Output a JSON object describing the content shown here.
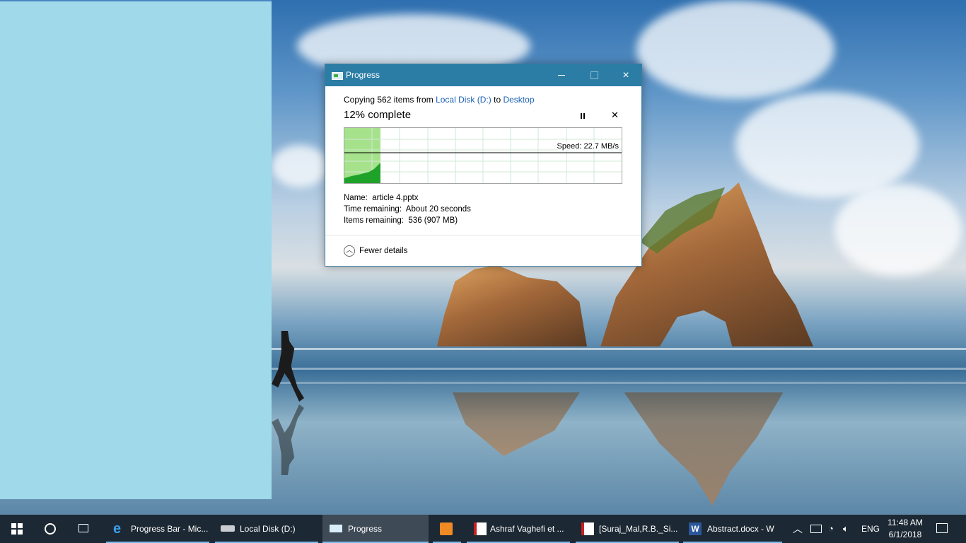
{
  "dialog": {
    "title": "Progress",
    "copy_prefix": "Copying 562 items from",
    "source": "Local Disk (D:)",
    "to_word": "to",
    "destination": "Desktop",
    "percent_text": "12% complete",
    "progress": 0.12,
    "speed": "Speed: 22.7 MB/s",
    "name_label": "Name:",
    "name_value": "article 4.pptx",
    "time_label": "Time remaining:",
    "time_value": "About 20 seconds",
    "items_label": "Items remaining:",
    "items_value": "536 (907 MB)",
    "fewer_details": "Fewer details",
    "controls": {
      "minimize": "minimize-icon",
      "maximize": "maximize-icon",
      "close": "×",
      "cancel": "✕"
    }
  },
  "taskbar": {
    "items": [
      {
        "label": "Progress Bar - Mic...",
        "icon": "edge-icon"
      },
      {
        "label": "Local Disk (D:)",
        "icon": "drive-icon"
      },
      {
        "label": "Progress",
        "icon": "copy-progress-icon"
      },
      {
        "label": "",
        "icon": "media-player-icon"
      },
      {
        "label": "Ashraf Vaghefi et ...",
        "icon": "pdf-icon"
      },
      {
        "label": "[Suraj_Mal,R.B._Si...",
        "icon": "pdf-icon"
      },
      {
        "label": "Abstract.docx - W",
        "icon": "word-icon"
      }
    ],
    "language": "ENG",
    "time": "11:48 AM",
    "date": "6/1/2018"
  },
  "colors": {
    "titlebar": "#2b7da5",
    "graph_fill": "#a6e28b",
    "graph_line": "#1fa22a",
    "left_panel": "#9fd9ea",
    "taskbar": "#1c2833"
  }
}
